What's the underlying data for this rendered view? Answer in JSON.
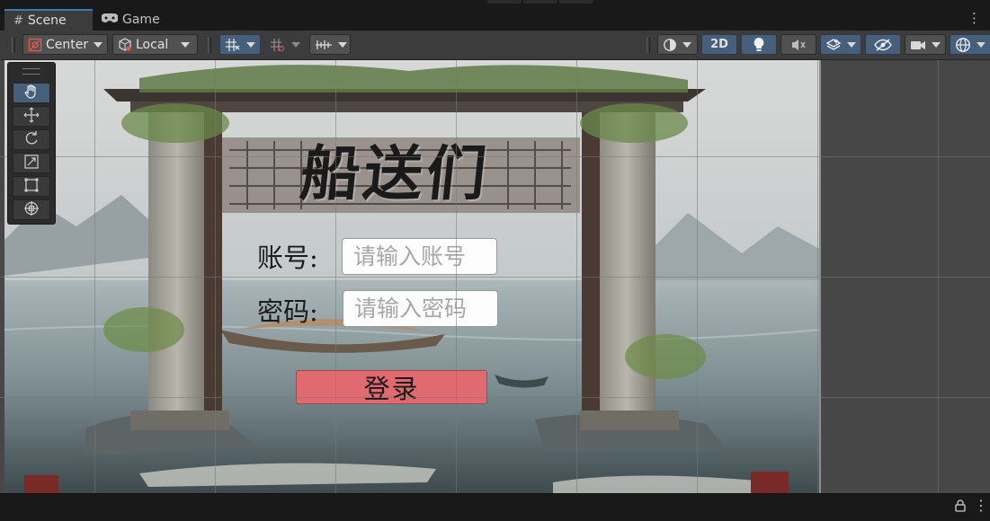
{
  "tabs": [
    {
      "label": "Scene",
      "icon": "grid-hash-icon",
      "active": true
    },
    {
      "label": "Game",
      "icon": "gamepad-icon",
      "active": false
    }
  ],
  "toolbar": {
    "pivot_mode": "Center",
    "pivot_rotation": "Local",
    "toggle_2d": "2D"
  },
  "tools": [
    "hand-tool",
    "move-tool",
    "rotate-tool",
    "scale-tool",
    "rect-tool",
    "transform-tool"
  ],
  "login": {
    "title": "船送们",
    "account_label": "账号:",
    "account_placeholder": "请输入账号",
    "password_label": "密码:",
    "password_placeholder": "请输入密码",
    "button_label": "登录"
  },
  "colors": {
    "accent_blue": "#46607c",
    "login_button": "#e06a6f"
  }
}
